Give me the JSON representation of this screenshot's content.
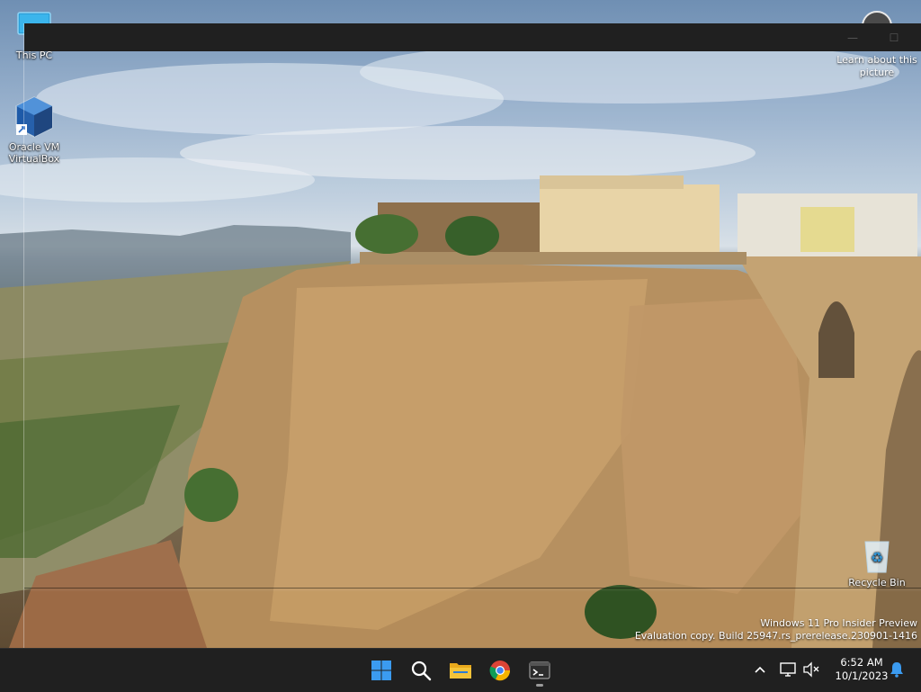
{
  "desktop": {
    "icons": [
      {
        "label": "This PC",
        "icon": "monitor-icon"
      },
      {
        "label": "Oracle VM VirtualBox",
        "icon": "virtualbox-cube-icon"
      },
      {
        "label": "Recycle Bin",
        "icon": "recycle-bin-icon"
      }
    ],
    "learn_about": {
      "label": "Learn about this picture",
      "icon": "camera-icon"
    },
    "watermark": {
      "line1": "Windows 11 Pro Insider Preview",
      "line2": "Evaluation copy. Build 25947.rs_prerelease.230901-1416"
    }
  },
  "window": {
    "controls": {
      "minimize": "—",
      "maximize": "☐"
    }
  },
  "taskbar": {
    "apps": [
      {
        "name": "Start",
        "icon": "windows-logo-icon"
      },
      {
        "name": "Search",
        "icon": "search-icon"
      },
      {
        "name": "File Explorer",
        "icon": "folder-icon"
      },
      {
        "name": "Google Chrome",
        "icon": "chrome-icon"
      },
      {
        "name": "Terminal",
        "icon": "terminal-icon",
        "running": true
      }
    ],
    "tray": {
      "chevron": "^",
      "time": "6:52 AM",
      "date": "10/1/2023"
    }
  },
  "colors": {
    "taskbar": "#202020",
    "accent": "#3b9bf0",
    "folder": "#f3c339"
  }
}
